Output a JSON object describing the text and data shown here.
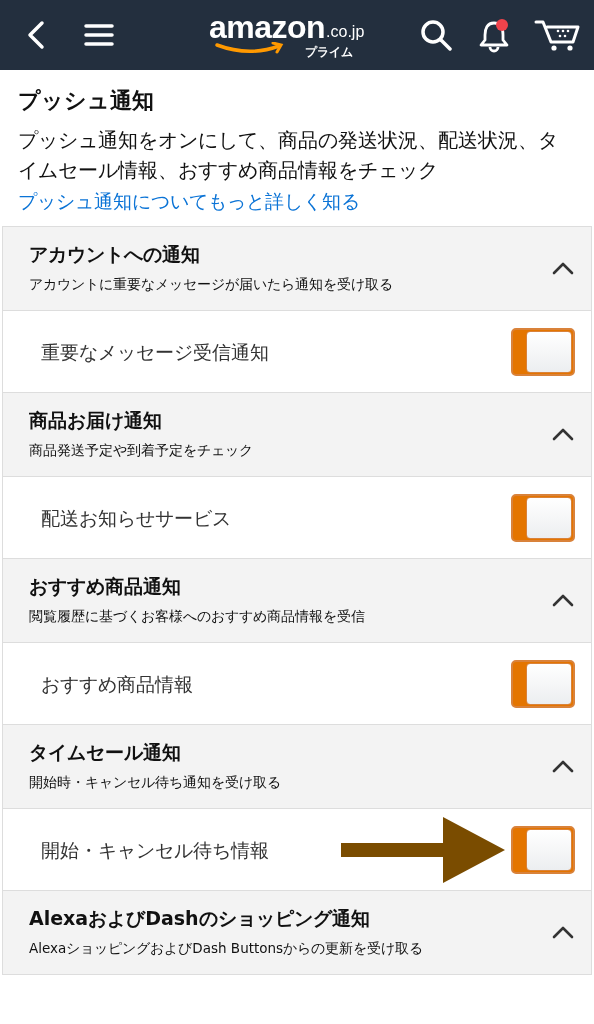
{
  "header": {
    "logo": {
      "word": "amazon",
      "domain": ".co.jp",
      "tagline": "プライム"
    },
    "notifications_unread": true
  },
  "page": {
    "title": "プッシュ通知",
    "description": "プッシュ通知をオンにして、商品の発送状況、配送状況、タイムセール情報、おすすめ商品情報をチェック",
    "link": "プッシュ通知についてもっと詳しく知る"
  },
  "sections": [
    {
      "title": "アカウントへの通知",
      "subtitle": "アカウントに重要なメッセージが届いたら通知を受け取る",
      "expanded": true,
      "items": [
        {
          "label": "重要なメッセージ受信通知",
          "on": true,
          "highlighted": false
        }
      ]
    },
    {
      "title": "商品お届け通知",
      "subtitle": "商品発送予定や到着予定をチェック",
      "expanded": true,
      "items": [
        {
          "label": "配送お知らせサービス",
          "on": true,
          "highlighted": false
        }
      ]
    },
    {
      "title": "おすすめ商品通知",
      "subtitle": "閲覧履歴に基づくお客様へのおすすめ商品情報を受信",
      "expanded": true,
      "items": [
        {
          "label": "おすすめ商品情報",
          "on": true,
          "highlighted": false
        }
      ]
    },
    {
      "title": "タイムセール通知",
      "subtitle": "開始時・キャンセル待ち通知を受け取る",
      "expanded": true,
      "items": [
        {
          "label": "開始・キャンセル待ち情報",
          "on": true,
          "highlighted": true
        }
      ]
    },
    {
      "title": "AlexaおよびDashのショッピング通知",
      "subtitle": "AlexaショッピングおよびDash Buttonsからの更新を受け取る",
      "expanded": true
    }
  ]
}
